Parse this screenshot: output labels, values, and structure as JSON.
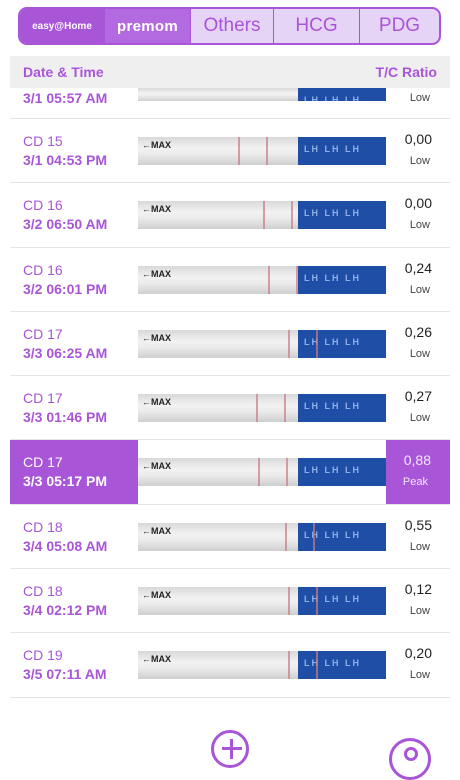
{
  "tabs": [
    {
      "label": "easy@Home",
      "active": true
    },
    {
      "label": "premom"
    },
    {
      "label": "Others"
    },
    {
      "label": "HCG"
    },
    {
      "label": "PDG"
    }
  ],
  "header": {
    "left": "Date & Time",
    "right": "T/C Ratio"
  },
  "rows": [
    {
      "cd": "",
      "datetime": "3/1  05:57 AM",
      "ratio": "",
      "level": "Low"
    },
    {
      "cd": "CD 15",
      "datetime": "3/1  04:53 PM",
      "ratio": "0,00",
      "level": "Low"
    },
    {
      "cd": "CD 16",
      "datetime": "3/2  06:50 AM",
      "ratio": "0,00",
      "level": "Low"
    },
    {
      "cd": "CD 16",
      "datetime": "3/2  06:01 PM",
      "ratio": "0,24",
      "level": "Low"
    },
    {
      "cd": "CD 17",
      "datetime": "3/3  06:25 AM",
      "ratio": "0,26",
      "level": "Low"
    },
    {
      "cd": "CD 17",
      "datetime": "3/3  01:46 PM",
      "ratio": "0,27",
      "level": "Low"
    },
    {
      "cd": "CD 17",
      "datetime": "3/3  05:17 PM",
      "ratio": "0,88",
      "level": "Peak",
      "selected": true
    },
    {
      "cd": "CD 18",
      "datetime": "3/4  05:08 AM",
      "ratio": "0,55",
      "level": "Low"
    },
    {
      "cd": "CD 18",
      "datetime": "3/4  02:12 PM",
      "ratio": "0,12",
      "level": "Low"
    },
    {
      "cd": "CD 19",
      "datetime": "3/5  07:11 AM",
      "ratio": "0,20",
      "level": "Low"
    }
  ],
  "strip": {
    "max_label": "MAX",
    "lh_label": "LH LH LH"
  },
  "icons": {
    "add": "add-icon",
    "corner": "settings-icon"
  }
}
